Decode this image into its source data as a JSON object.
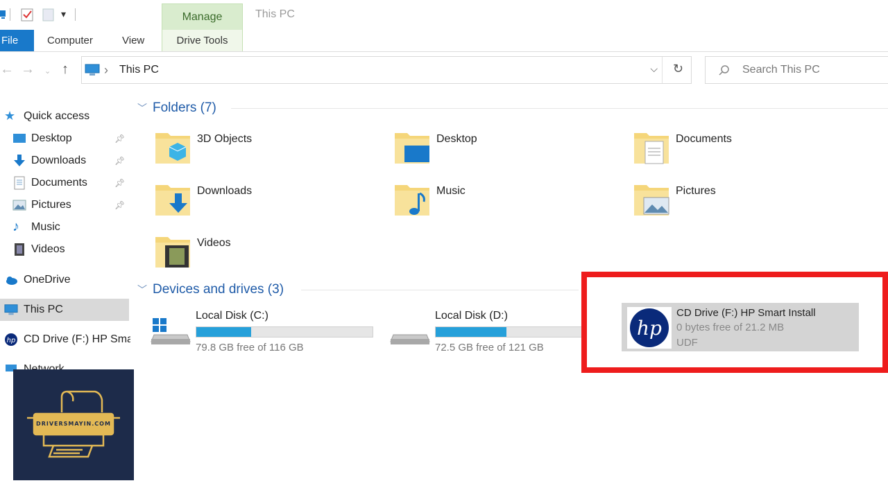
{
  "window": {
    "title": "This PC",
    "contextual_tab": "Manage"
  },
  "ribbon": {
    "tabs": [
      {
        "label": "File"
      },
      {
        "label": "Computer"
      },
      {
        "label": "View"
      },
      {
        "label": "Drive Tools"
      }
    ]
  },
  "address_bar": {
    "path": "This PC",
    "search_placeholder": "Search This PC"
  },
  "sidebar": {
    "quick_access": "Quick access",
    "items": [
      {
        "label": "Desktop",
        "icon": "desktop-icon",
        "pinned": true
      },
      {
        "label": "Downloads",
        "icon": "download-arrow-icon",
        "pinned": true
      },
      {
        "label": "Documents",
        "icon": "document-icon",
        "pinned": true
      },
      {
        "label": "Pictures",
        "icon": "picture-icon",
        "pinned": true
      },
      {
        "label": "Music",
        "icon": "music-note-icon",
        "pinned": false
      },
      {
        "label": "Videos",
        "icon": "film-icon",
        "pinned": false
      }
    ],
    "onedrive": "OneDrive",
    "this_pc": "This PC",
    "cd_drive": "CD Drive (F:) HP Sma",
    "network": "Network"
  },
  "folders": {
    "header": "Folders (7)",
    "items": [
      {
        "name": "3D Objects",
        "icon": "cube-icon"
      },
      {
        "name": "Desktop",
        "icon": "desktop-icon"
      },
      {
        "name": "Documents",
        "icon": "document-icon"
      },
      {
        "name": "Downloads",
        "icon": "download-arrow-icon"
      },
      {
        "name": "Music",
        "icon": "music-note-icon"
      },
      {
        "name": "Pictures",
        "icon": "picture-icon"
      },
      {
        "name": "Videos",
        "icon": "film-icon"
      }
    ]
  },
  "devices": {
    "header": "Devices and drives (3)",
    "drives": [
      {
        "name": "Local Disk (C:)",
        "free": "79.8 GB free of 116 GB",
        "used_fraction": 0.31,
        "icon": "windows-drive-icon"
      },
      {
        "name": "Local Disk (D:)",
        "free": "72.5 GB free of 121 GB",
        "used_fraction": 0.4,
        "icon": "hard-drive-icon"
      }
    ],
    "cd": {
      "name": "CD Drive (F:) HP Smart Install",
      "free": "0 bytes free of 21.2 MB",
      "filesystem": "UDF",
      "logo_text": "hp"
    }
  },
  "watermark": {
    "text": "DRIVERSMAYIN.COM"
  },
  "colors": {
    "accent": "#1979ca",
    "manage_tab": "#d9ecce",
    "highlight": "#ee1c1c",
    "progress": "#26a0da",
    "hp_blue": "#0a2a7a",
    "watermark_bg": "#1d2b4a",
    "watermark_gold": "#e3b955"
  }
}
